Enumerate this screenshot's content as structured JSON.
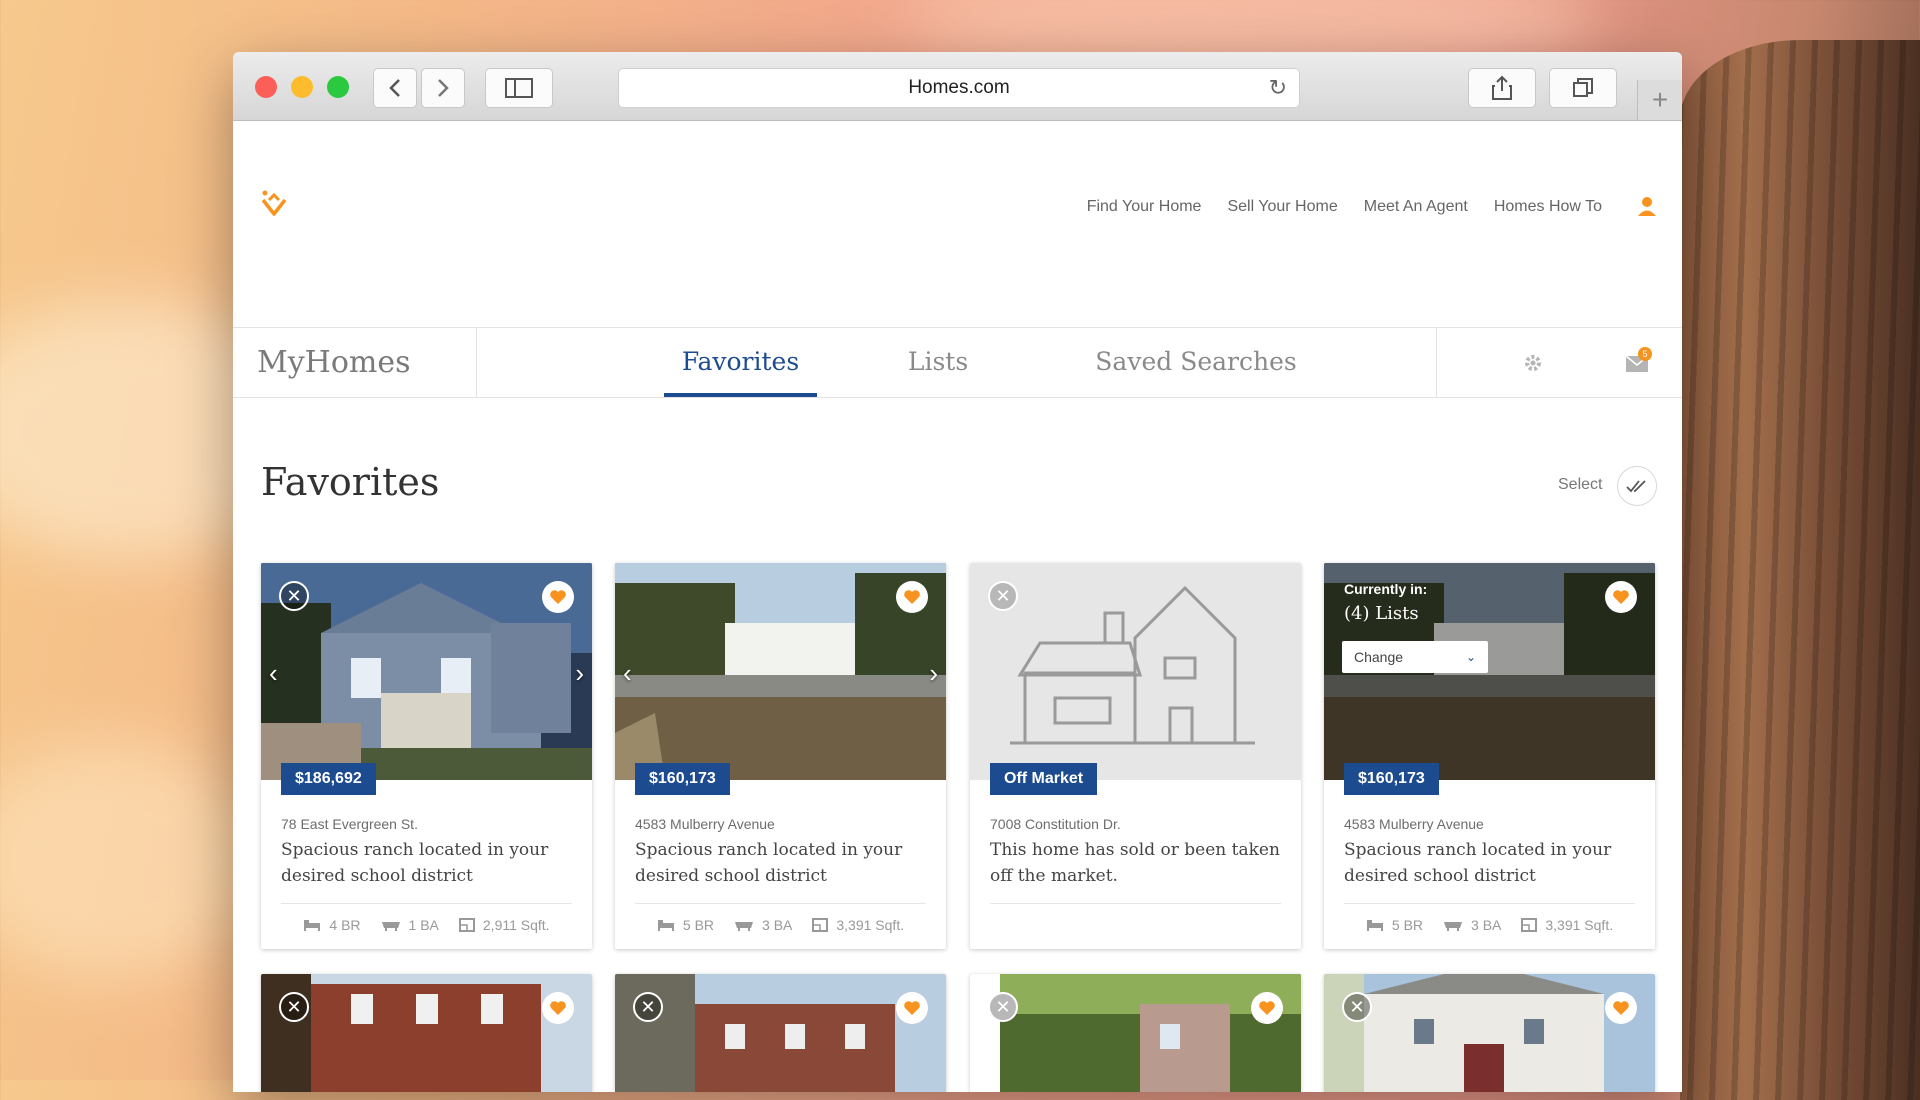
{
  "browser": {
    "address": "Homes.com"
  },
  "site": {
    "nav": [
      "Find Your Home",
      "Sell Your Home",
      "Meet An Agent",
      "Homes How To"
    ],
    "brand": "MyHomes",
    "tabs": [
      "Favorites",
      "Lists",
      "Saved Searches"
    ],
    "mail_count": "5"
  },
  "page": {
    "title": "Favorites",
    "select_label": "Select"
  },
  "cards": [
    {
      "price": "$186,692",
      "address": "78 East Evergreen St.",
      "description": "Spacious ranch located in your desired school district",
      "beds": "4 BR",
      "baths": "1 BA",
      "sqft": "2,911 Sqft."
    },
    {
      "price": "$160,173",
      "address": "4583 Mulberry Avenue",
      "description": "Spacious ranch located in your desired school district",
      "beds": "5 BR",
      "baths": "3 BA",
      "sqft": "3,391 Sqft."
    },
    {
      "price": "Off Market",
      "address": "7008 Constitution Dr.",
      "description": "This home has sold or been taken off the market."
    },
    {
      "price": "$160,173",
      "address": "4583 Mulberry Avenue",
      "description": "Spacious ranch located in your desired school district",
      "beds": "5 BR",
      "baths": "3 BA",
      "sqft": "3,391 Sqft.",
      "currently_in": "Currently in:",
      "lists": "(4) Lists",
      "change": "Change"
    }
  ],
  "colors": {
    "accent_orange": "#f7931e",
    "brand_blue": "#1d4b8f"
  }
}
